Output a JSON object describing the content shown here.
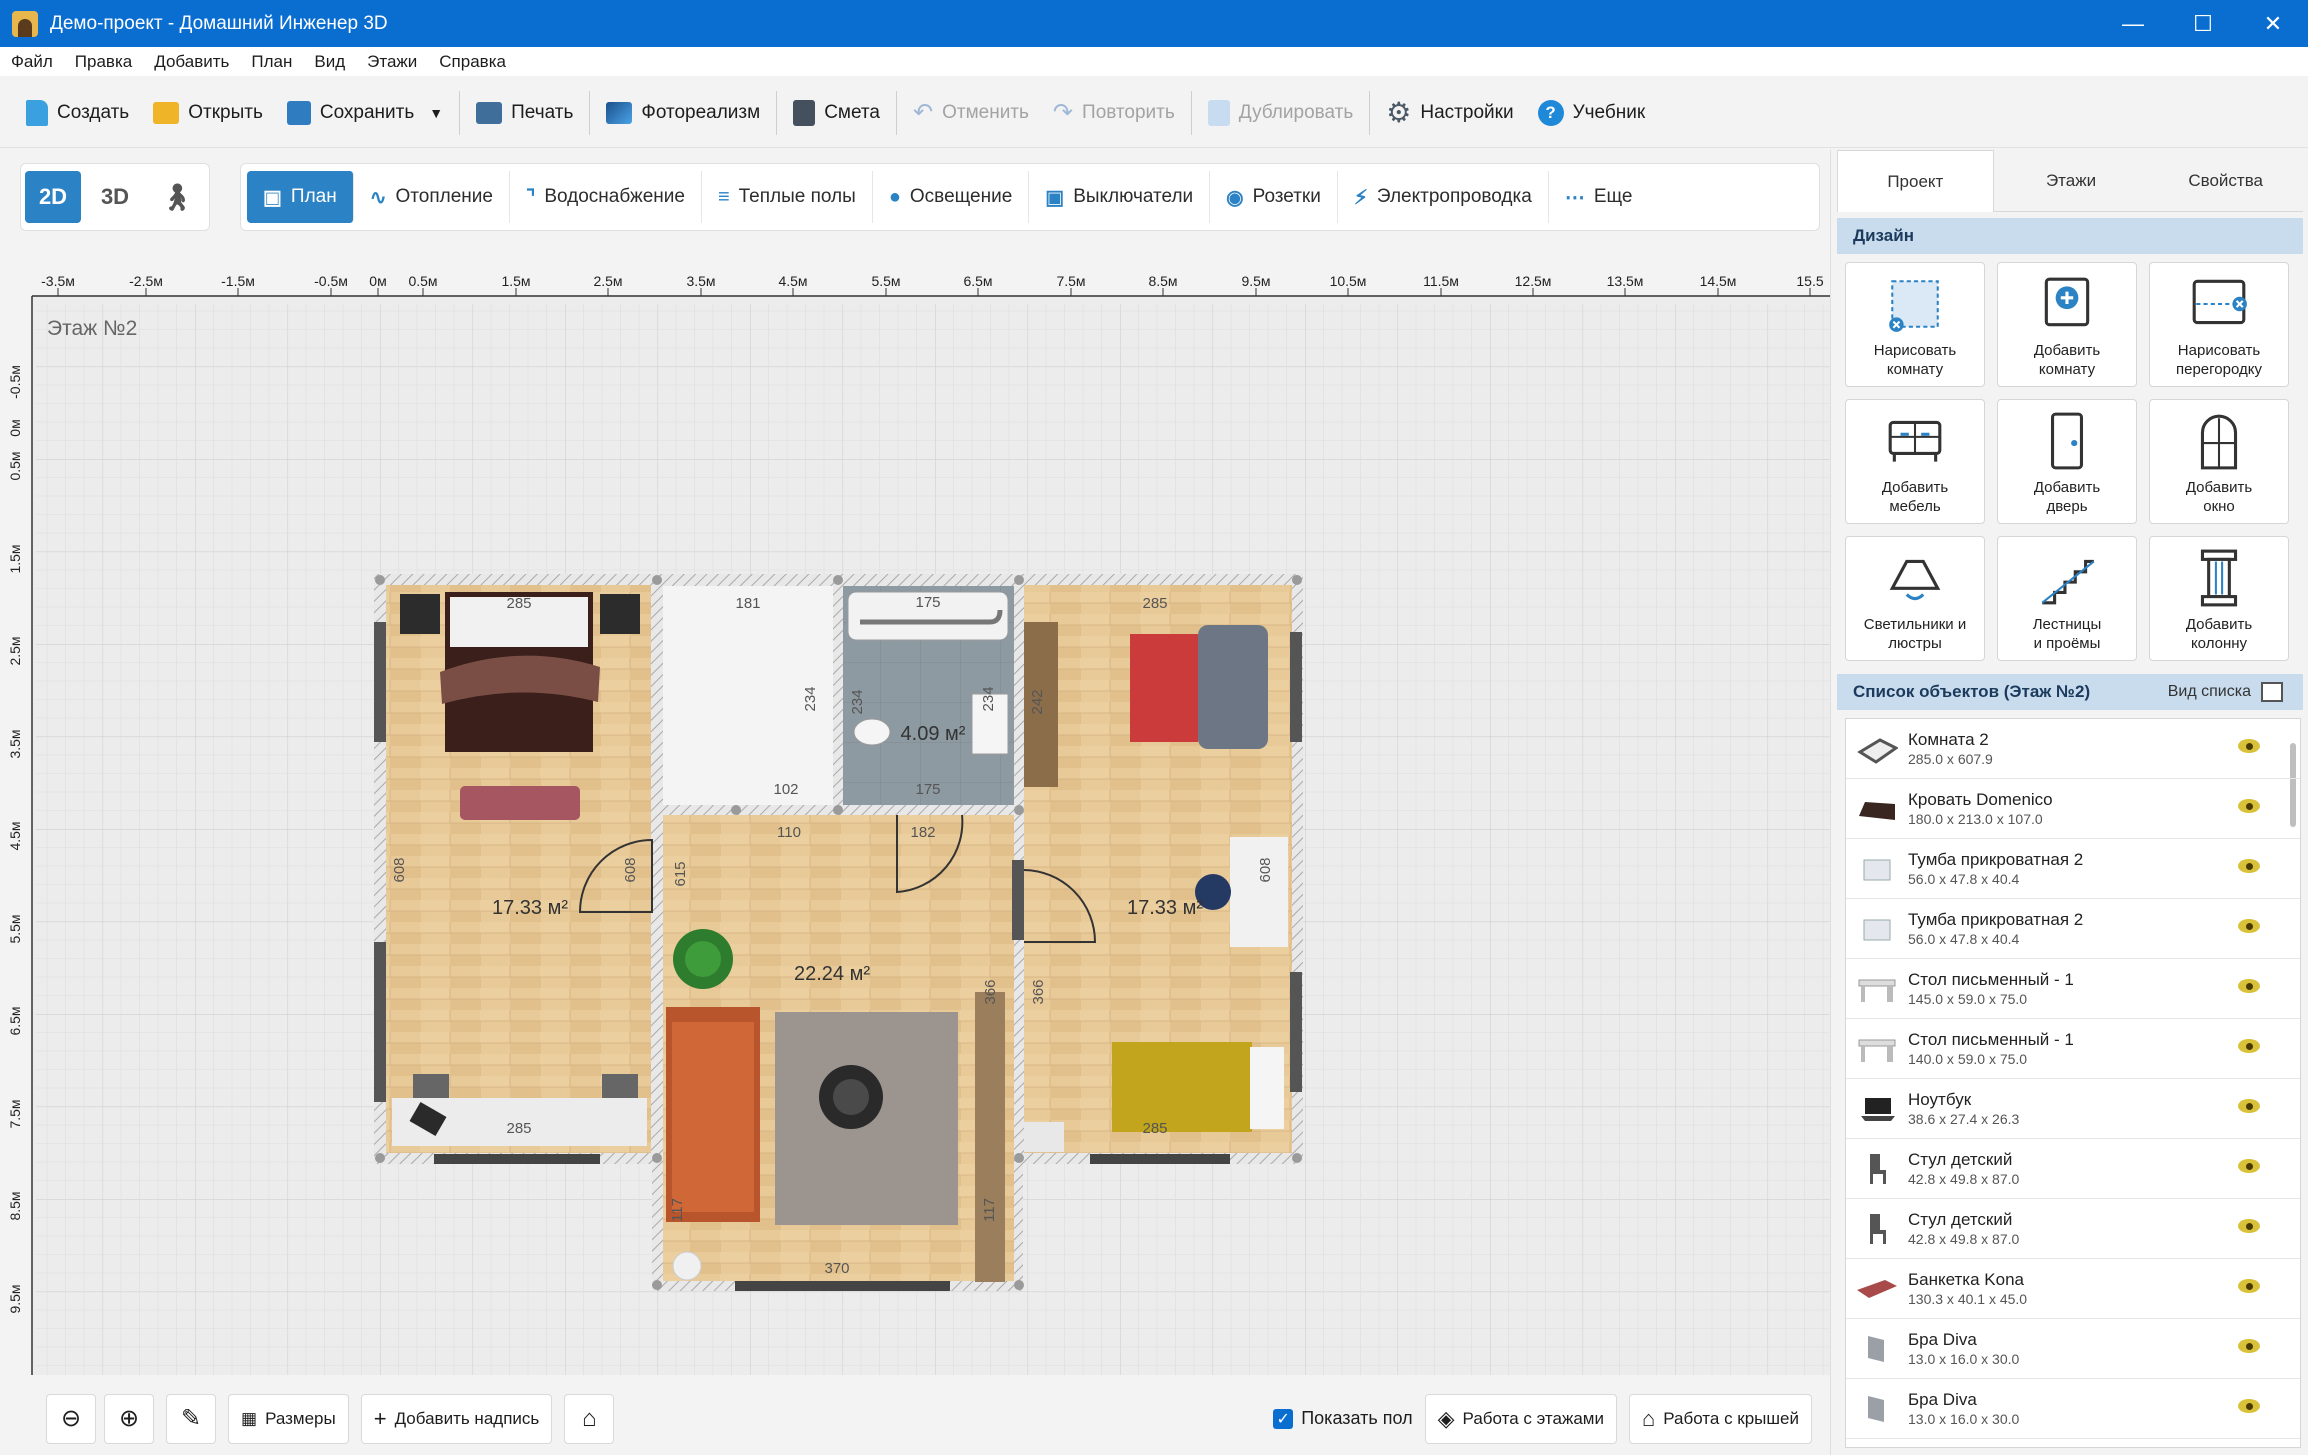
{
  "window": {
    "title": "Демо-проект - Домашний Инженер 3D"
  },
  "menu": [
    "Файл",
    "Правка",
    "Добавить",
    "План",
    "Вид",
    "Этажи",
    "Справка"
  ],
  "toolbar": {
    "create": "Создать",
    "open": "Открыть",
    "save": "Сохранить",
    "print": "Печать",
    "photoreal": "Фотореализм",
    "estimate": "Смета",
    "undo": "Отменить",
    "redo": "Повторить",
    "duplicate": "Дублировать",
    "settings": "Настройки",
    "tutorial": "Учебник"
  },
  "views": {
    "v2d": "2D",
    "v3d": "3D"
  },
  "modes": [
    "План",
    "Отопление",
    "Водоснабжение",
    "Теплые полы",
    "Освещение",
    "Выключатели",
    "Розетки",
    "Электропроводка",
    "Еще"
  ],
  "canvas": {
    "floor_label": "Этаж №2",
    "ruler_x": [
      "-3.5м",
      "-2.5м",
      "-1.5м",
      "-0.5м",
      "0м",
      "0.5м",
      "1.5м",
      "2.5м",
      "3.5м",
      "4.5м",
      "5.5м",
      "6.5м",
      "7.5м",
      "8.5м",
      "9.5м",
      "10.5м",
      "11.5м",
      "12.5м",
      "13.5м",
      "14.5м",
      "15.5"
    ],
    "ruler_y": [
      "-0.5м",
      "0м",
      "0.5м",
      "1.5м",
      "2.5м",
      "3.5м",
      "4.5м",
      "5.5м",
      "6.5м",
      "7.5м",
      "8.5м",
      "9.5м"
    ],
    "rooms": {
      "bedroom_left_area": "17.33 м²",
      "bath_area": "4.09 м²",
      "hall_area": "22.24 м²",
      "bedroom_right_area": "17.33 м²"
    },
    "dims": {
      "d285a": "285",
      "d181": "181",
      "d175a": "175",
      "d285b": "285",
      "d234a": "234",
      "d234b": "234",
      "d242": "242",
      "d102": "102",
      "d175b": "175",
      "d110": "110",
      "d182": "182",
      "d608a": "608",
      "d608b": "608",
      "d615": "615",
      "d608c": "608",
      "d366a": "366",
      "d366b": "366",
      "d285c": "285",
      "d285d": "285",
      "d117a": "117",
      "d117b": "117",
      "d370": "370",
      "d234c": "234"
    }
  },
  "bottombar": {
    "dimensions": "Размеры",
    "add_label": "Добавить надпись",
    "show_floor": "Показать пол",
    "floors_work": "Работа с этажами",
    "roof_work": "Работа с крышей"
  },
  "panel": {
    "tabs": [
      "Проект",
      "Этажи",
      "Свойства"
    ],
    "design_title": "Дизайн",
    "design_items": [
      {
        "l1": "Нарисовать",
        "l2": "комнату",
        "icon": "draw-room-icon"
      },
      {
        "l1": "Добавить",
        "l2": "комнату",
        "icon": "add-room-icon"
      },
      {
        "l1": "Нарисовать",
        "l2": "перегородку",
        "icon": "draw-partition-icon"
      },
      {
        "l1": "Добавить",
        "l2": "мебель",
        "icon": "furniture-icon"
      },
      {
        "l1": "Добавить",
        "l2": "дверь",
        "icon": "door-icon"
      },
      {
        "l1": "Добавить",
        "l2": "окно",
        "icon": "window-icon"
      },
      {
        "l1": "Светильники и",
        "l2": "люстры",
        "icon": "lamp-icon"
      },
      {
        "l1": "Лестницы",
        "l2": "и проёмы",
        "icon": "stairs-icon"
      },
      {
        "l1": "Добавить",
        "l2": "колонну",
        "icon": "column-icon"
      }
    ],
    "list_title": "Список объектов (Этаж №2)",
    "list_view": "Вид списка",
    "objects": [
      {
        "name": "Комната 2",
        "dim": "285.0 x 607.9"
      },
      {
        "name": "Кровать Domenico",
        "dim": "180.0 x 213.0 x 107.0"
      },
      {
        "name": "Тумба прикроватная 2",
        "dim": "56.0 x 47.8 x 40.4"
      },
      {
        "name": "Тумба прикроватная 2",
        "dim": "56.0 x 47.8 x 40.4"
      },
      {
        "name": "Стол письменный - 1",
        "dim": "145.0 x 59.0 x 75.0"
      },
      {
        "name": "Стол письменный - 1",
        "dim": "140.0 x 59.0 x 75.0"
      },
      {
        "name": "Ноутбук",
        "dim": "38.6 x 27.4 x 26.3"
      },
      {
        "name": "Стул детский",
        "dim": "42.8 x 49.8 x 87.0"
      },
      {
        "name": "Стул детский",
        "dim": "42.8 x 49.8 x 87.0"
      },
      {
        "name": "Банкетка Kona",
        "dim": "130.3 x 40.1 x 45.0"
      },
      {
        "name": "Бра Diva",
        "dim": "13.0 x 16.0 x 30.0"
      },
      {
        "name": "Бра Diva",
        "dim": "13.0 x 16.0 x 30.0"
      }
    ]
  }
}
